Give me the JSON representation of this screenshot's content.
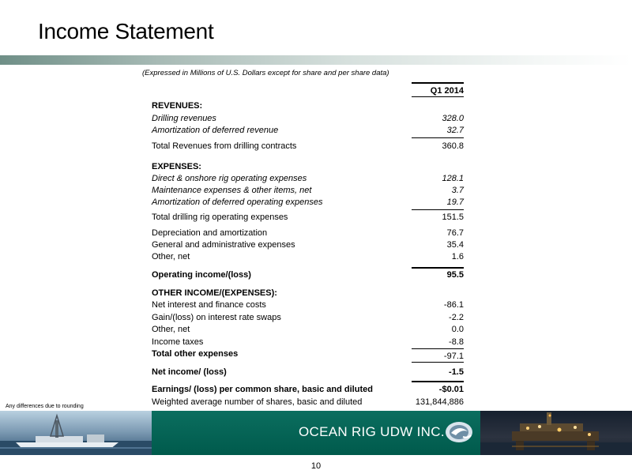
{
  "slide": {
    "title": "Income Statement",
    "subtitle": "(Expressed in Millions of U.S. Dollars except for share and per share data)",
    "column_header": "Q1 2014",
    "footnote": "Any differences due to rounding",
    "company": "OCEAN RIG UDW INC.",
    "page_number": "10"
  },
  "rows": [
    {
      "label": "REVENUES:",
      "value": ""
    },
    {
      "label": "Drilling revenues",
      "value": "328.0"
    },
    {
      "label": "Amortization of deferred revenue",
      "value": "32.7"
    },
    {
      "label": "Total Revenues from drilling contracts",
      "value": "360.8"
    },
    {
      "label": "EXPENSES:",
      "value": ""
    },
    {
      "label": "Direct & onshore rig operating expenses",
      "value": "128.1"
    },
    {
      "label": "Maintenance  expenses & other items, net",
      "value": "3.7"
    },
    {
      "label": "Amortization of deferred operating expenses",
      "value": "19.7"
    },
    {
      "label": "Total drilling rig operating expenses",
      "value": "151.5"
    },
    {
      "label": "Depreciation and amortization",
      "value": "76.7"
    },
    {
      "label": "General and administrative expenses",
      "value": "35.4"
    },
    {
      "label": "Other, net",
      "value": "1.6"
    },
    {
      "label": "Operating income/(loss)",
      "value": "95.5"
    },
    {
      "label": "OTHER INCOME/(EXPENSES):",
      "value": ""
    },
    {
      "label": "Net interest and finance costs",
      "value": "-86.1"
    },
    {
      "label": "Gain/(loss) on interest rate swaps",
      "value": "-2.2"
    },
    {
      "label": "Other, net",
      "value": "0.0"
    },
    {
      "label": "Income taxes",
      "value": "-8.8"
    },
    {
      "label": "Total other expenses",
      "value": "-97.1"
    },
    {
      "label": "Net  income/ (loss)",
      "value": "-1.5"
    },
    {
      "label": "Earnings/ (loss) per common share, basic and diluted",
      "value": "-$0.01"
    },
    {
      "label": "Weighted average number of shares, basic and diluted",
      "value": "131,844,886"
    }
  ]
}
